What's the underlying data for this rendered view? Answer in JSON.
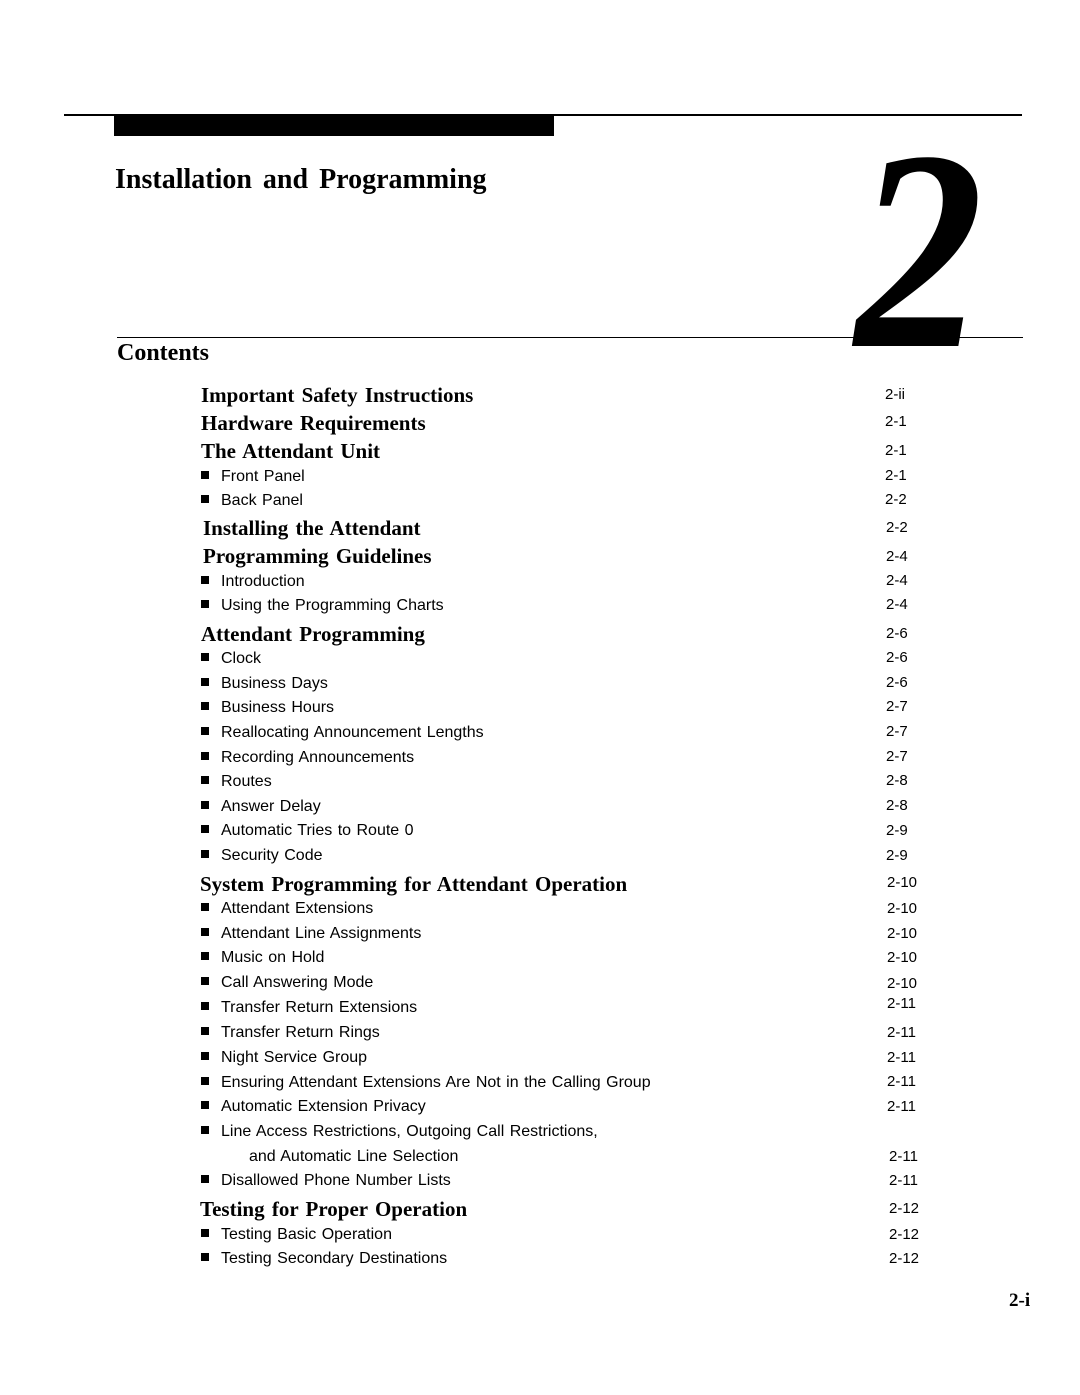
{
  "chapter": {
    "title": "Installation and Programming",
    "number": "2"
  },
  "contents_heading": "Contents",
  "toc": [
    {
      "type": "head",
      "label": "Important Safety Instructions",
      "page": "2-ii"
    },
    {
      "type": "head",
      "label": "Hardware Requirements",
      "page": "2-1"
    },
    {
      "type": "head",
      "label": "The Attendant Unit",
      "page": "2-1"
    },
    {
      "type": "sub",
      "label": "Front Panel",
      "page": "2-1"
    },
    {
      "type": "sub",
      "label": "Back Panel",
      "page": "2-2"
    },
    {
      "type": "head",
      "label": "Installing the Attendant",
      "page": "2-2"
    },
    {
      "type": "head",
      "label": "Programming Guidelines",
      "page": "2-4"
    },
    {
      "type": "sub",
      "label": "Introduction",
      "page": "2-4"
    },
    {
      "type": "sub",
      "label": "Using the Programming Charts",
      "page": "2-4"
    },
    {
      "type": "head",
      "label": "Attendant Programming",
      "page": "2-6"
    },
    {
      "type": "sub",
      "label": "Clock",
      "page": "2-6"
    },
    {
      "type": "sub",
      "label": "Business Days",
      "page": "2-6"
    },
    {
      "type": "sub",
      "label": "Business Hours",
      "page": "2-7"
    },
    {
      "type": "sub",
      "label": "Reallocating Announcement Lengths",
      "page": "2-7"
    },
    {
      "type": "sub",
      "label": "Recording Announcements",
      "page": "2-7"
    },
    {
      "type": "sub",
      "label": "Routes",
      "page": "2-8"
    },
    {
      "type": "sub",
      "label": "Answer Delay",
      "page": "2-8"
    },
    {
      "type": "sub",
      "label": "Automatic Tries to Route 0",
      "page": "2-9"
    },
    {
      "type": "sub",
      "label": "Security Code",
      "page": "2-9"
    },
    {
      "type": "head",
      "label": "System Programming for Attendant Operation",
      "page": "2-10"
    },
    {
      "type": "sub",
      "label": "Attendant Extensions",
      "page": "2-10"
    },
    {
      "type": "sub",
      "label": "Attendant Line Assignments",
      "page": "2-10"
    },
    {
      "type": "sub",
      "label": "Music on Hold",
      "page": "2-10"
    },
    {
      "type": "sub",
      "label": "Call Answering Mode",
      "page": "2-10"
    },
    {
      "type": "sub",
      "label": "Transfer Return Extensions",
      "page": "2-11"
    },
    {
      "type": "sub",
      "label": "Transfer Return Rings",
      "page": "2-11"
    },
    {
      "type": "sub",
      "label": "Night Service Group",
      "page": "2-11"
    },
    {
      "type": "sub",
      "label": "Ensuring Attendant Extensions Are Not in the Calling Group",
      "page": "2-11"
    },
    {
      "type": "sub",
      "label": "Automatic Extension Privacy",
      "page": "2-11"
    },
    {
      "type": "sub",
      "label": "Line Access Restrictions, Outgoing Call Restrictions,",
      "page": ""
    },
    {
      "type": "cont",
      "label": "and Automatic Line Selection",
      "page": "2-11"
    },
    {
      "type": "sub",
      "label": "Disallowed Phone Number Lists",
      "page": "2-11"
    },
    {
      "type": "head",
      "label": "Testing for Proper Operation",
      "page": "2-12"
    },
    {
      "type": "sub",
      "label": "Testing Basic Operation",
      "page": "2-12"
    },
    {
      "type": "sub",
      "label": "Testing Secondary Destinations",
      "page": "2-12"
    }
  ],
  "folio": "2-i"
}
